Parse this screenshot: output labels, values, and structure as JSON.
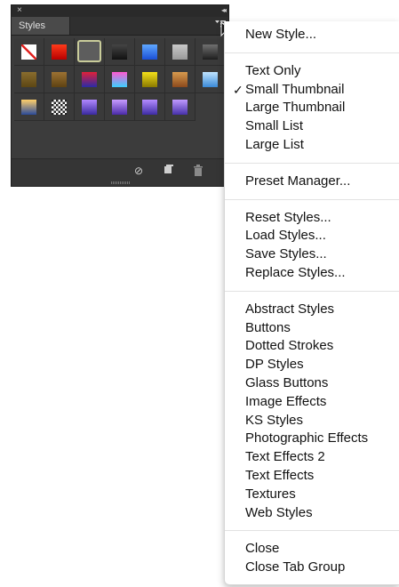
{
  "panel": {
    "close_glyph": "×",
    "collapse_glyph": "◂◂",
    "tab_label": "Styles",
    "menu_glyph": "▾≡"
  },
  "swatches": [
    {
      "name": "none-style",
      "colors": [
        "#ffffff",
        "#c0c0c0"
      ]
    },
    {
      "name": "red-glow",
      "colors": [
        "#ff3a1a",
        "#b80000"
      ]
    },
    {
      "name": "selected-gray",
      "colors": [
        "#6a6a6a",
        "#505050"
      ]
    },
    {
      "name": "dark-button",
      "colors": [
        "#444444",
        "#111111"
      ]
    },
    {
      "name": "blue-glass",
      "colors": [
        "#5fa8ff",
        "#1a4fd6"
      ]
    },
    {
      "name": "light-gray",
      "colors": [
        "#c8c8c8",
        "#9a9a9a"
      ]
    },
    {
      "name": "dark-gradient",
      "colors": [
        "#707070",
        "#1e1e1e"
      ]
    },
    {
      "name": "olive",
      "colors": [
        "#8a6d2e",
        "#5c4614"
      ]
    },
    {
      "name": "bronze",
      "colors": [
        "#9c7233",
        "#5e4212"
      ]
    },
    {
      "name": "red-blue-stripe",
      "colors": [
        "#e0213a",
        "#2a2aa6"
      ]
    },
    {
      "name": "multicolor",
      "colors": [
        "#ff5ad0",
        "#3ad0ff"
      ]
    },
    {
      "name": "yellow-bevel",
      "colors": [
        "#f4e01a",
        "#8a7a00"
      ]
    },
    {
      "name": "copper",
      "colors": [
        "#d89b4e",
        "#8c4a1c"
      ]
    },
    {
      "name": "sky-blue",
      "colors": [
        "#bfe4ff",
        "#3a8ad8"
      ]
    },
    {
      "name": "sunset",
      "colors": [
        "#ffcf6a",
        "#2a4a9a"
      ]
    },
    {
      "name": "checker",
      "colors": [
        "#ffffff",
        "#222222"
      ]
    },
    {
      "name": "purple-blue-a",
      "colors": [
        "#b088ff",
        "#3a2aa0"
      ]
    },
    {
      "name": "purple-blue-b",
      "colors": [
        "#c89cff",
        "#4a2aa8"
      ]
    },
    {
      "name": "purple-blue-c",
      "colors": [
        "#b48cff",
        "#3d2ca4"
      ]
    },
    {
      "name": "purple-blue-d",
      "colors": [
        "#c09aff",
        "#4630aa"
      ]
    }
  ],
  "panel_bottom": {
    "clear_icon": "⊘",
    "new_icon": "■",
    "trash_icon": "🗑"
  },
  "menu": {
    "items": [
      {
        "label": "New Style...",
        "checked": false
      },
      {
        "label": "Text Only",
        "checked": false
      },
      {
        "label": "Small Thumbnail",
        "checked": true
      },
      {
        "label": "Large Thumbnail",
        "checked": false
      },
      {
        "label": "Small List",
        "checked": false
      },
      {
        "label": "Large List",
        "checked": false
      },
      {
        "label": "Preset Manager...",
        "checked": false
      },
      {
        "label": "Reset Styles...",
        "checked": false
      },
      {
        "label": "Load Styles...",
        "checked": false
      },
      {
        "label": "Save Styles...",
        "checked": false
      },
      {
        "label": "Replace Styles...",
        "checked": false
      },
      {
        "label": "Abstract Styles",
        "checked": false
      },
      {
        "label": "Buttons",
        "checked": false
      },
      {
        "label": "Dotted Strokes",
        "checked": false
      },
      {
        "label": "DP Styles",
        "checked": false
      },
      {
        "label": "Glass Buttons",
        "checked": false
      },
      {
        "label": "Image Effects",
        "checked": false
      },
      {
        "label": "KS Styles",
        "checked": false
      },
      {
        "label": "Photographic Effects",
        "checked": false
      },
      {
        "label": "Text Effects 2",
        "checked": false
      },
      {
        "label": "Text Effects",
        "checked": false
      },
      {
        "label": "Textures",
        "checked": false
      },
      {
        "label": "Web Styles",
        "checked": false
      },
      {
        "label": "Close",
        "checked": false
      },
      {
        "label": "Close Tab Group",
        "checked": false
      }
    ],
    "check_glyph": "✓"
  }
}
